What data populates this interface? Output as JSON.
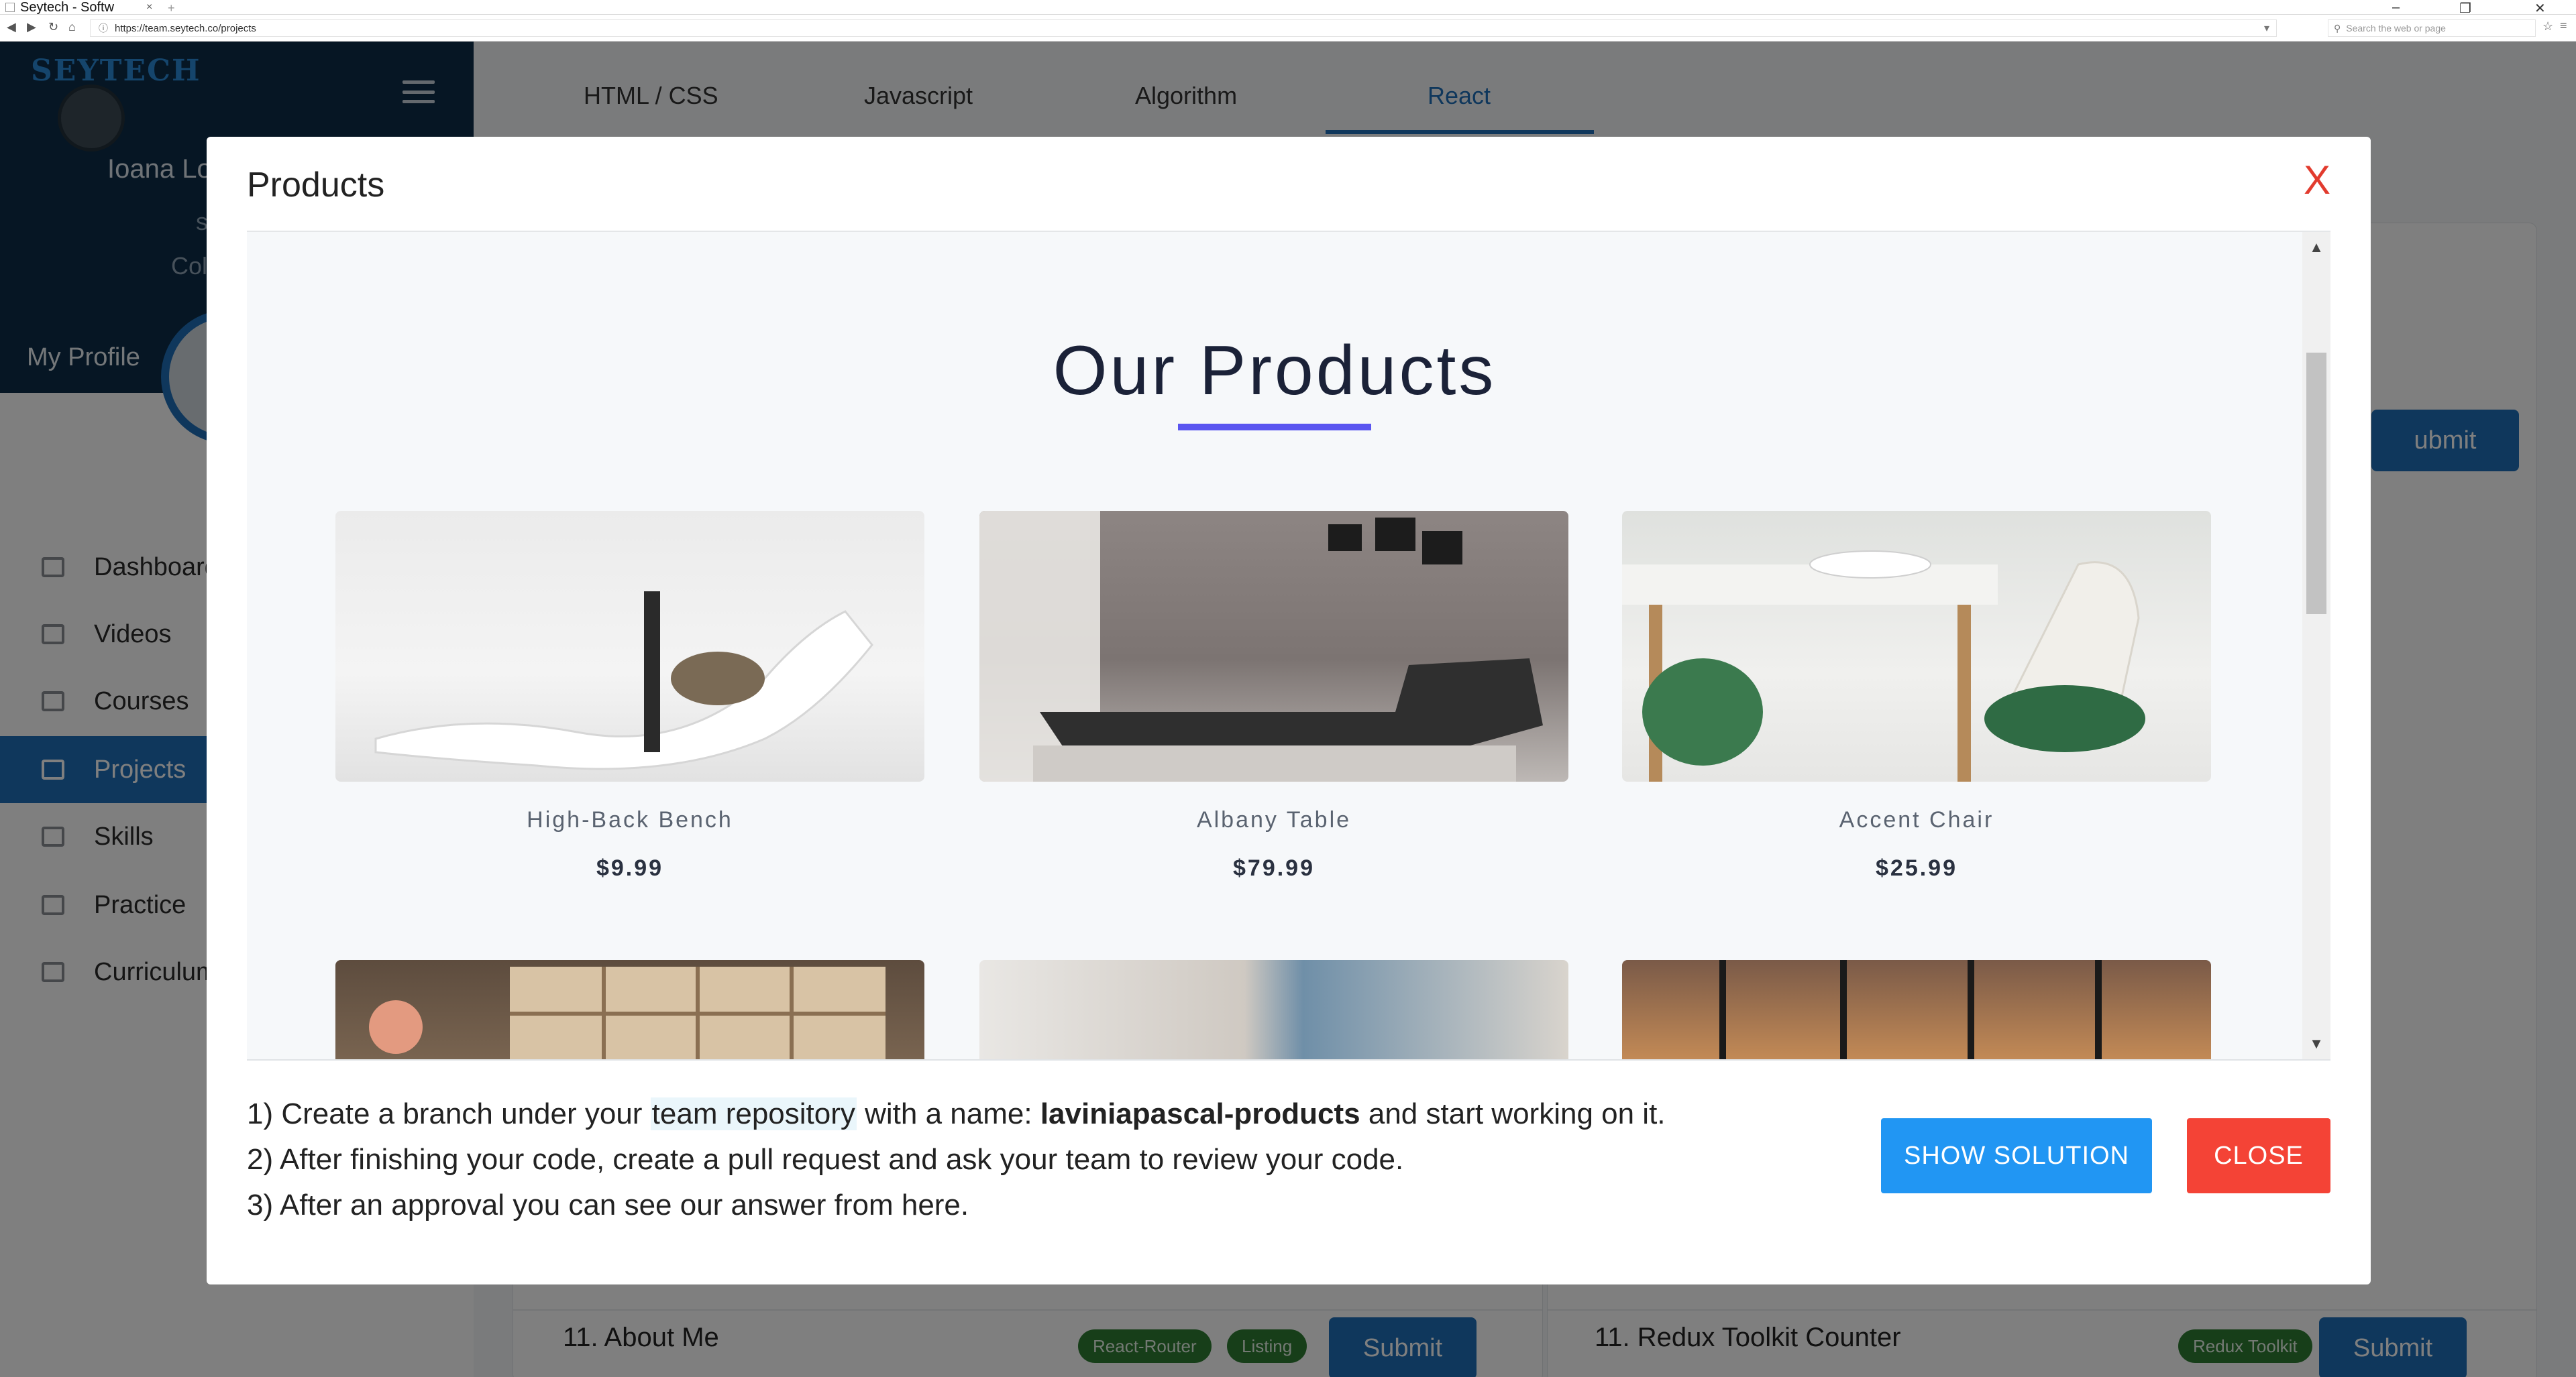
{
  "browser": {
    "tab_title": "Seytech - Softw",
    "url": "https://team.seytech.co/projects",
    "search_placeholder": "Search the web or page"
  },
  "sidebar": {
    "brand": "SEYTECH",
    "user_name": "Ioana Lo",
    "user_line2": "s",
    "user_line3": "Col",
    "my_profile": "My Profile",
    "items": [
      {
        "label": "Dashboard",
        "icon": "dashboard-icon"
      },
      {
        "label": "Videos",
        "icon": "video-icon"
      },
      {
        "label": "Courses",
        "icon": "graduation-cap-icon"
      },
      {
        "label": "Projects",
        "icon": "bookmark-icon",
        "active": true
      },
      {
        "label": "Skills",
        "icon": "folder-icon"
      },
      {
        "label": "Practice",
        "icon": "book-icon"
      },
      {
        "label": "Curriculum",
        "icon": "calendar-icon"
      }
    ]
  },
  "main": {
    "tabs": [
      "HTML / CSS",
      "Javascript",
      "Algorithm",
      "React"
    ],
    "active_tab": "React",
    "submit_label": "Submit",
    "left_bottom_row": {
      "title": "11. About Me",
      "tags": [
        "React-Router",
        "Listing"
      ]
    },
    "right_bottom_row": {
      "title": "11. Redux Toolkit Counter",
      "tags": [
        "Redux Toolkit"
      ]
    },
    "partial_submit_label": "ubmit"
  },
  "modal": {
    "title": "Products",
    "close_x": "X",
    "preview": {
      "heading": "Our Products",
      "products": [
        {
          "name": "High-Back Bench",
          "price": "$9.99"
        },
        {
          "name": "Albany Table",
          "price": "$79.99"
        },
        {
          "name": "Accent Chair",
          "price": "$25.99"
        }
      ]
    },
    "instructions": {
      "line1_prefix": "1) Create a branch under your ",
      "line1_link": "team repository",
      "line1_mid": " with a name: ",
      "line1_branch": "laviniapascal-products",
      "line1_suffix": " and start working on it.",
      "line2": "2) After finishing your code, create a pull request and ask your team to review your code.",
      "line3": "3) After an approval you can see our answer from here."
    },
    "show_solution_label": "SHOW SOLUTION",
    "close_label": "CLOSE"
  },
  "colors": {
    "sidebar_header": "#0c2d48",
    "accent_blue": "#1e6fb8",
    "solution_blue": "#2196f3",
    "close_red": "#f44336",
    "heading_underline": "#5a55f0"
  }
}
